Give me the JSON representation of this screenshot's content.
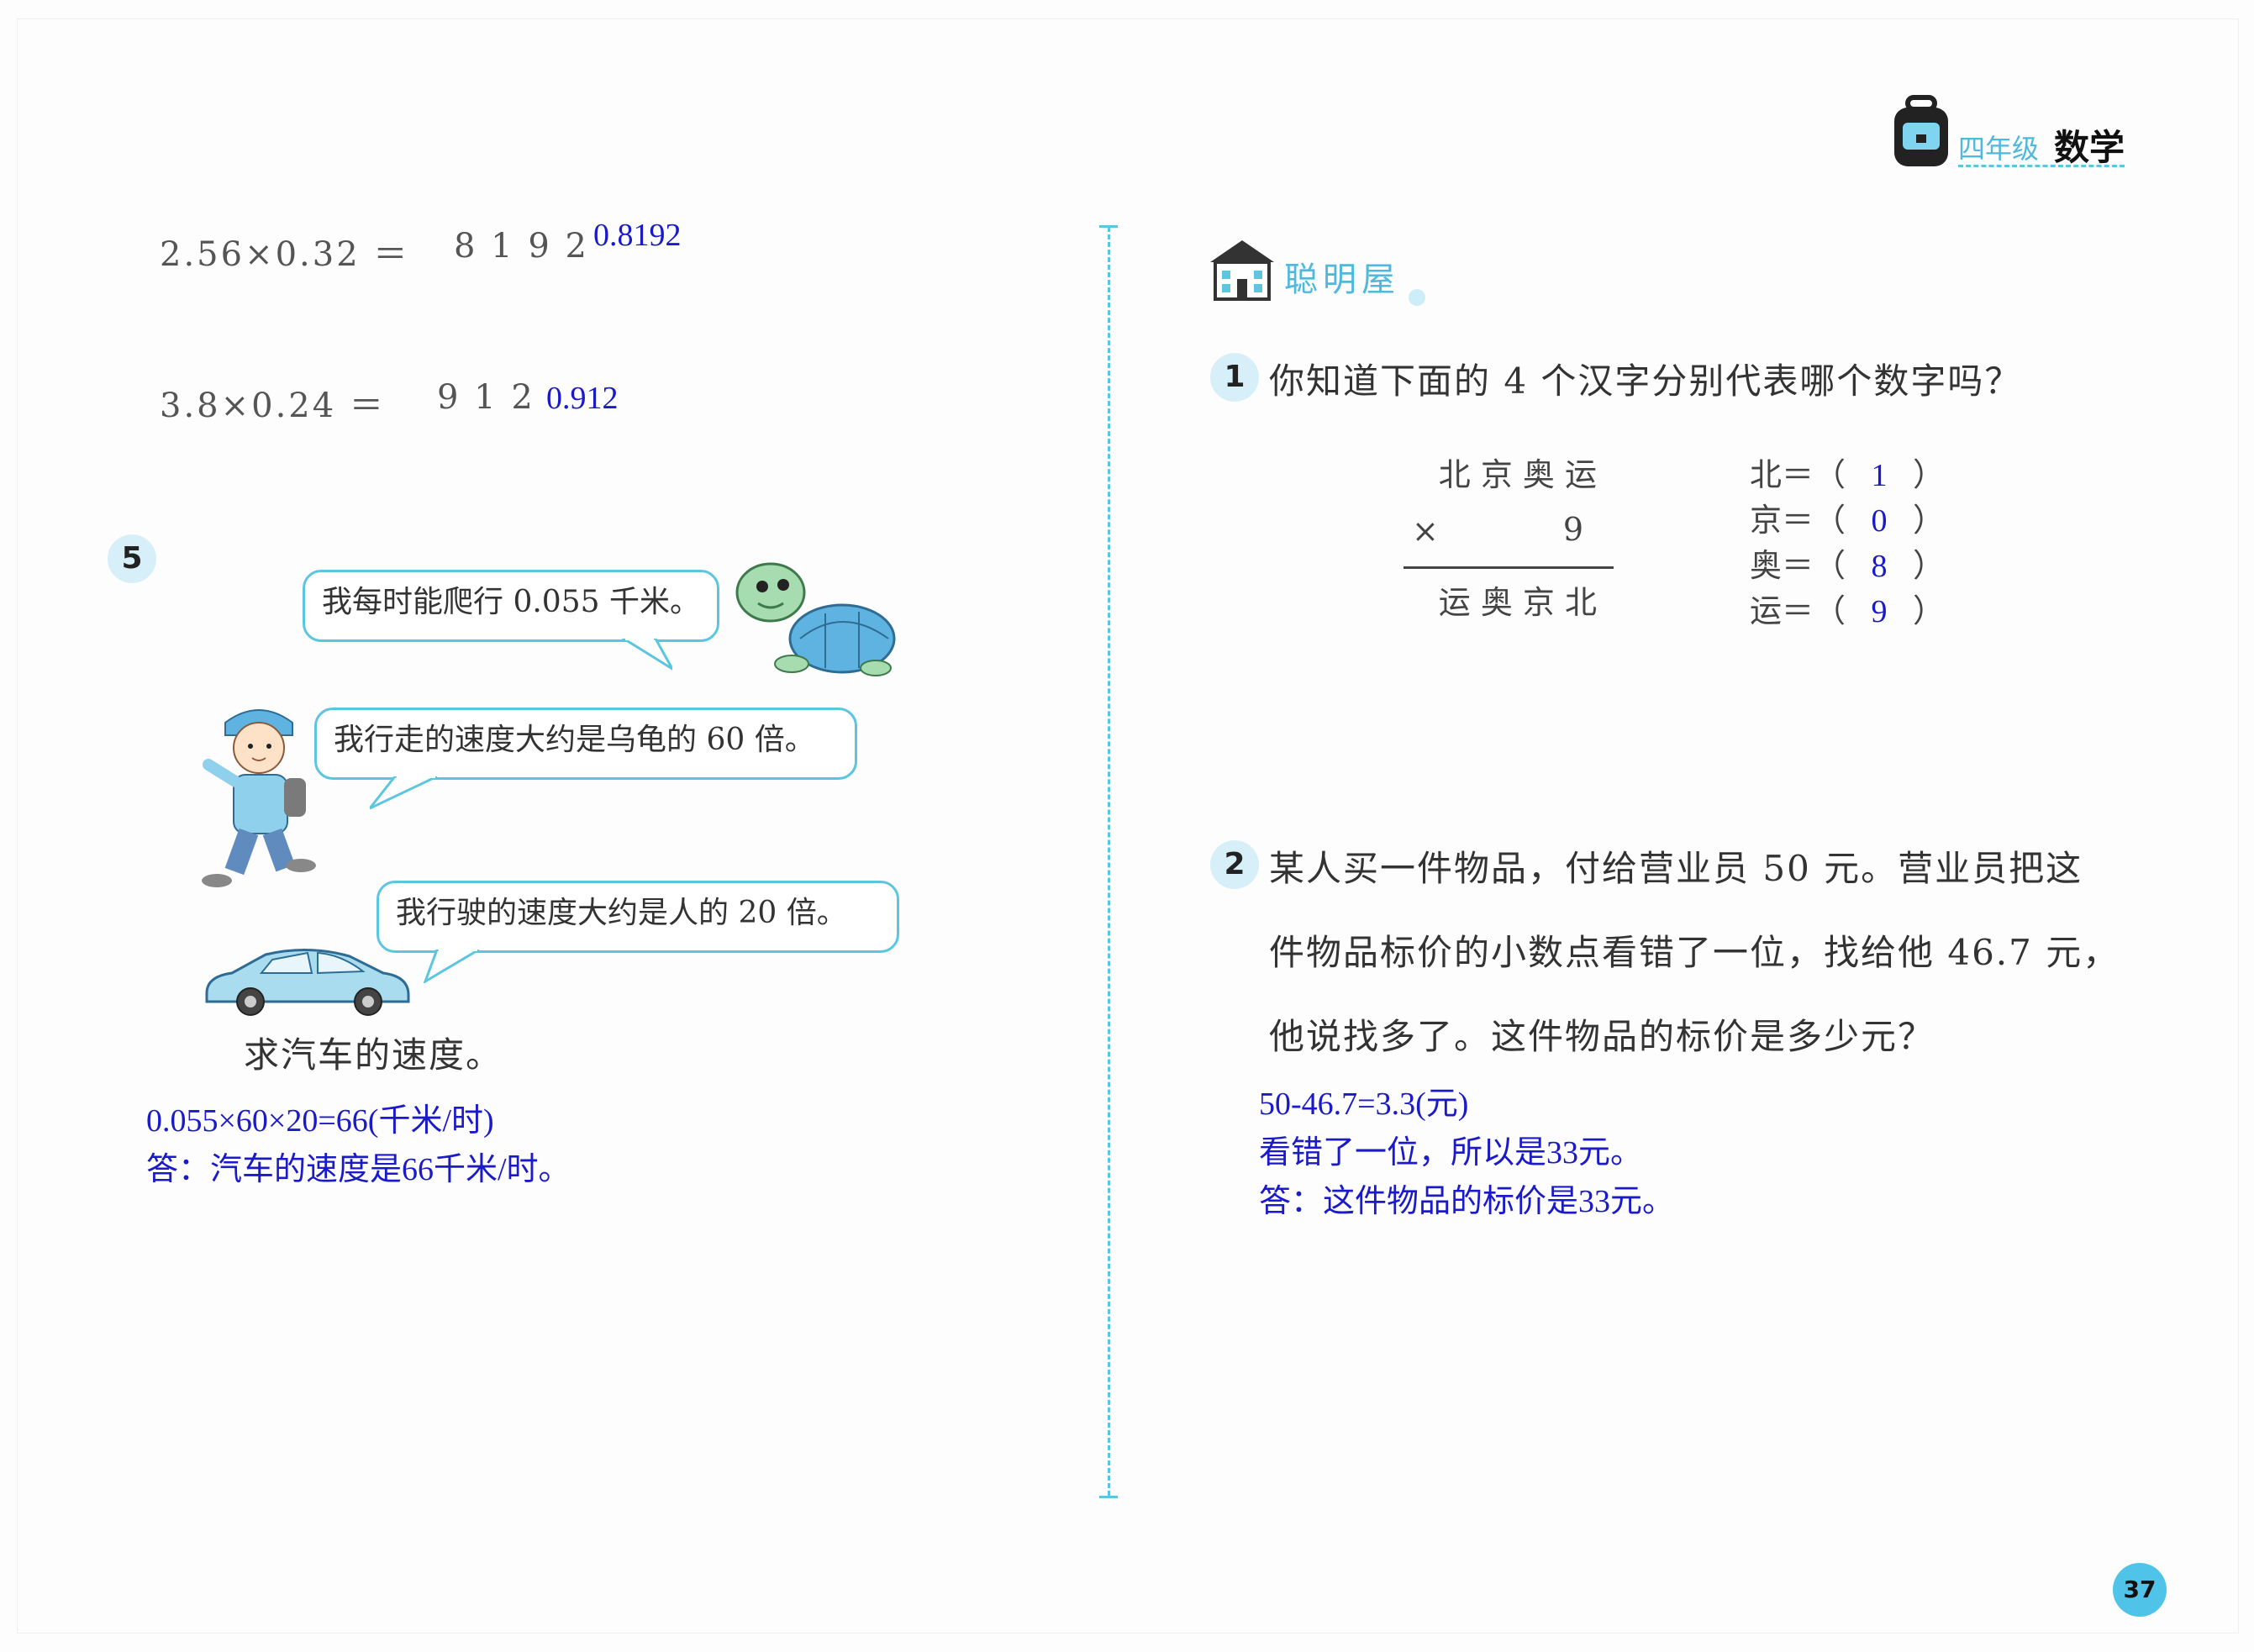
{
  "header": {
    "grade": "四年级",
    "subject": "数学"
  },
  "left": {
    "eq1": {
      "expr": "2.56×0.32 ＝",
      "digits": "8 1 9 2",
      "answer": "0.8192"
    },
    "eq2": {
      "expr": "3.8×0.24 ＝",
      "digits": "9 1 2",
      "answer": "0.912"
    },
    "q5": {
      "number": "5",
      "bubble_turtle": "我每时能爬行 0.055 千米。",
      "bubble_boy": "我行走的速度大约是乌龟的 60 倍。",
      "bubble_car": "我行驶的速度大约是人的 20 倍。",
      "question": "求汽车的速度。",
      "answer_line1": "0.055×60×20=66(千米/时)",
      "answer_line2": "答：汽车的速度是66千米/时。"
    }
  },
  "right": {
    "section_title": "聪明屋",
    "q1": {
      "number": "1",
      "text": "你知道下面的 4 个汉字分别代表哪个数字吗？",
      "multiplicand": "北 京 奥 运",
      "times_sign": "×",
      "multiplier": "9",
      "product": "运 奥 京 北",
      "rows": [
        {
          "label": "北＝（",
          "value": "1",
          "close": "）"
        },
        {
          "label": "京＝（",
          "value": "0",
          "close": "）"
        },
        {
          "label": "奥＝（",
          "value": "8",
          "close": "）"
        },
        {
          "label": "运＝（",
          "value": "9",
          "close": "）"
        }
      ]
    },
    "q2": {
      "number": "2",
      "line1": "某人买一件物品，付给营业员 50 元。营业员把这",
      "line2": "件物品标价的小数点看错了一位，找给他 46.7 元，",
      "line3": "他说找多了。这件物品的标价是多少元？",
      "answer_line1": "50-46.7=3.3(元)",
      "answer_line2": "看错了一位，所以是33元。",
      "answer_line3": "答：这件物品的标价是33元。"
    }
  },
  "footer": {
    "page_number": "37"
  },
  "colors": {
    "accent": "#5cc6e0",
    "answer": "#1a1ac8",
    "badge": "#4fc3e8"
  }
}
